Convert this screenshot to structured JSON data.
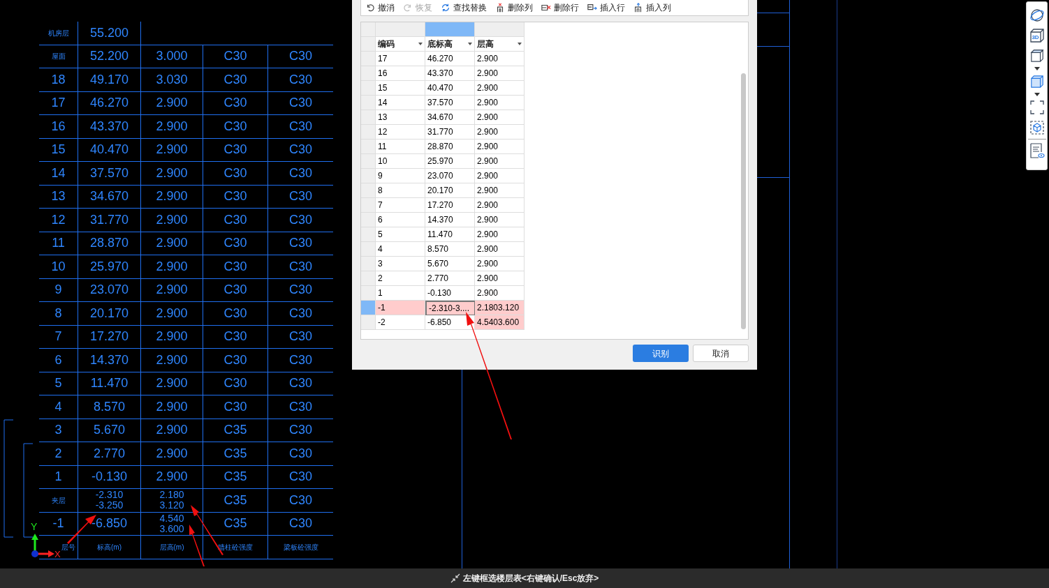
{
  "cad_table": {
    "rows": [
      {
        "cells": [
          "机房层",
          "55.200"
        ]
      },
      {
        "cells": [
          "屋面",
          "52.200",
          "3.000",
          "C30",
          "C30"
        ]
      },
      {
        "cells": [
          "18",
          "49.170",
          "3.030",
          "C30",
          "C30"
        ]
      },
      {
        "cells": [
          "17",
          "46.270",
          "2.900",
          "C30",
          "C30"
        ]
      },
      {
        "cells": [
          "16",
          "43.370",
          "2.900",
          "C30",
          "C30"
        ]
      },
      {
        "cells": [
          "15",
          "40.470",
          "2.900",
          "C30",
          "C30"
        ]
      },
      {
        "cells": [
          "14",
          "37.570",
          "2.900",
          "C30",
          "C30"
        ]
      },
      {
        "cells": [
          "13",
          "34.670",
          "2.900",
          "C30",
          "C30"
        ]
      },
      {
        "cells": [
          "12",
          "31.770",
          "2.900",
          "C30",
          "C30"
        ]
      },
      {
        "cells": [
          "11",
          "28.870",
          "2.900",
          "C30",
          "C30"
        ]
      },
      {
        "cells": [
          "10",
          "25.970",
          "2.900",
          "C30",
          "C30"
        ]
      },
      {
        "cells": [
          "9",
          "23.070",
          "2.900",
          "C30",
          "C30"
        ]
      },
      {
        "cells": [
          "8",
          "20.170",
          "2.900",
          "C30",
          "C30"
        ]
      },
      {
        "cells": [
          "7",
          "17.270",
          "2.900",
          "C30",
          "C30"
        ]
      },
      {
        "cells": [
          "6",
          "14.370",
          "2.900",
          "C30",
          "C30"
        ]
      },
      {
        "cells": [
          "5",
          "11.470",
          "2.900",
          "C30",
          "C30"
        ]
      },
      {
        "cells": [
          "4",
          "8.570",
          "2.900",
          "C30",
          "C30"
        ]
      },
      {
        "cells": [
          "3",
          "5.670",
          "2.900",
          "C35",
          "C30"
        ]
      },
      {
        "cells": [
          "2",
          "2.770",
          "2.900",
          "C35",
          "C30"
        ]
      },
      {
        "cells": [
          "1",
          "-0.130",
          "2.900",
          "C35",
          "C30"
        ]
      },
      {
        "cells": [
          "夹层",
          "-2.310\n-3.250",
          "2.180\n3.120",
          "C35",
          "C30"
        ]
      },
      {
        "cells": [
          "-1",
          "-6.850",
          "4.540\n3.600",
          "C35",
          "C30"
        ]
      },
      {
        "cells": [
          "层号",
          "标高(m)",
          "层高(m)",
          "墙柱砼强度",
          "梁板砼强度"
        ]
      }
    ]
  },
  "axis": {
    "x_label": "X",
    "y_label": "Y"
  },
  "dialog": {
    "toolbar": [
      {
        "kind": "undo",
        "label": "撤消",
        "disabled": false
      },
      {
        "kind": "redo",
        "label": "恢复",
        "disabled": true
      },
      {
        "kind": "replace",
        "label": "查找替换",
        "disabled": false
      },
      {
        "kind": "delete_column",
        "label": "删除列",
        "disabled": false
      },
      {
        "kind": "delete_row",
        "label": "删除行",
        "disabled": false
      },
      {
        "kind": "insert_row",
        "label": "插入行",
        "disabled": false
      },
      {
        "kind": "insert_column",
        "label": "插入列",
        "disabled": false
      }
    ],
    "columns": [
      {
        "label": "编码",
        "selected": false
      },
      {
        "label": "底标高",
        "selected": true
      },
      {
        "label": "层高",
        "selected": false
      }
    ],
    "rows": [
      {
        "selected": false,
        "cells": [
          {
            "text": "17",
            "invalid": false,
            "focused": false
          },
          {
            "text": "46.270",
            "invalid": false,
            "focused": false
          },
          {
            "text": "2.900",
            "invalid": false,
            "focused": false
          }
        ]
      },
      {
        "selected": false,
        "cells": [
          {
            "text": "16",
            "invalid": false,
            "focused": false
          },
          {
            "text": "43.370",
            "invalid": false,
            "focused": false
          },
          {
            "text": "2.900",
            "invalid": false,
            "focused": false
          }
        ]
      },
      {
        "selected": false,
        "cells": [
          {
            "text": "15",
            "invalid": false,
            "focused": false
          },
          {
            "text": "40.470",
            "invalid": false,
            "focused": false
          },
          {
            "text": "2.900",
            "invalid": false,
            "focused": false
          }
        ]
      },
      {
        "selected": false,
        "cells": [
          {
            "text": "14",
            "invalid": false,
            "focused": false
          },
          {
            "text": "37.570",
            "invalid": false,
            "focused": false
          },
          {
            "text": "2.900",
            "invalid": false,
            "focused": false
          }
        ]
      },
      {
        "selected": false,
        "cells": [
          {
            "text": "13",
            "invalid": false,
            "focused": false
          },
          {
            "text": "34.670",
            "invalid": false,
            "focused": false
          },
          {
            "text": "2.900",
            "invalid": false,
            "focused": false
          }
        ]
      },
      {
        "selected": false,
        "cells": [
          {
            "text": "12",
            "invalid": false,
            "focused": false
          },
          {
            "text": "31.770",
            "invalid": false,
            "focused": false
          },
          {
            "text": "2.900",
            "invalid": false,
            "focused": false
          }
        ]
      },
      {
        "selected": false,
        "cells": [
          {
            "text": "11",
            "invalid": false,
            "focused": false
          },
          {
            "text": "28.870",
            "invalid": false,
            "focused": false
          },
          {
            "text": "2.900",
            "invalid": false,
            "focused": false
          }
        ]
      },
      {
        "selected": false,
        "cells": [
          {
            "text": "10",
            "invalid": false,
            "focused": false
          },
          {
            "text": "25.970",
            "invalid": false,
            "focused": false
          },
          {
            "text": "2.900",
            "invalid": false,
            "focused": false
          }
        ]
      },
      {
        "selected": false,
        "cells": [
          {
            "text": "9",
            "invalid": false,
            "focused": false
          },
          {
            "text": "23.070",
            "invalid": false,
            "focused": false
          },
          {
            "text": "2.900",
            "invalid": false,
            "focused": false
          }
        ]
      },
      {
        "selected": false,
        "cells": [
          {
            "text": "8",
            "invalid": false,
            "focused": false
          },
          {
            "text": "20.170",
            "invalid": false,
            "focused": false
          },
          {
            "text": "2.900",
            "invalid": false,
            "focused": false
          }
        ]
      },
      {
        "selected": false,
        "cells": [
          {
            "text": "7",
            "invalid": false,
            "focused": false
          },
          {
            "text": "17.270",
            "invalid": false,
            "focused": false
          },
          {
            "text": "2.900",
            "invalid": false,
            "focused": false
          }
        ]
      },
      {
        "selected": false,
        "cells": [
          {
            "text": "6",
            "invalid": false,
            "focused": false
          },
          {
            "text": "14.370",
            "invalid": false,
            "focused": false
          },
          {
            "text": "2.900",
            "invalid": false,
            "focused": false
          }
        ]
      },
      {
        "selected": false,
        "cells": [
          {
            "text": "5",
            "invalid": false,
            "focused": false
          },
          {
            "text": "11.470",
            "invalid": false,
            "focused": false
          },
          {
            "text": "2.900",
            "invalid": false,
            "focused": false
          }
        ]
      },
      {
        "selected": false,
        "cells": [
          {
            "text": "4",
            "invalid": false,
            "focused": false
          },
          {
            "text": "8.570",
            "invalid": false,
            "focused": false
          },
          {
            "text": "2.900",
            "invalid": false,
            "focused": false
          }
        ]
      },
      {
        "selected": false,
        "cells": [
          {
            "text": "3",
            "invalid": false,
            "focused": false
          },
          {
            "text": "5.670",
            "invalid": false,
            "focused": false
          },
          {
            "text": "2.900",
            "invalid": false,
            "focused": false
          }
        ]
      },
      {
        "selected": false,
        "cells": [
          {
            "text": "2",
            "invalid": false,
            "focused": false
          },
          {
            "text": "2.770",
            "invalid": false,
            "focused": false
          },
          {
            "text": "2.900",
            "invalid": false,
            "focused": false
          }
        ]
      },
      {
        "selected": false,
        "cells": [
          {
            "text": "1",
            "invalid": false,
            "focused": false
          },
          {
            "text": "-0.130",
            "invalid": false,
            "focused": false
          },
          {
            "text": "2.900",
            "invalid": false,
            "focused": false
          }
        ]
      },
      {
        "selected": true,
        "cells": [
          {
            "text": "-1",
            "invalid": true,
            "focused": false
          },
          {
            "text": "-2.310-3....",
            "invalid": true,
            "focused": true
          },
          {
            "text": "2.1803.120",
            "invalid": true,
            "focused": false
          }
        ]
      },
      {
        "selected": false,
        "cells": [
          {
            "text": "-2",
            "invalid": false,
            "focused": false
          },
          {
            "text": "-6.850",
            "invalid": false,
            "focused": false
          },
          {
            "text": "4.5403.600",
            "invalid": true,
            "focused": false
          }
        ]
      }
    ],
    "buttons": [
      {
        "kind": "primary",
        "label": "识别"
      },
      {
        "kind": "secondary",
        "label": "取消"
      }
    ]
  },
  "view_toolbar": [
    {
      "kind": "orbit"
    },
    {
      "kind": "cube_3d",
      "label": "3D"
    },
    {
      "kind": "cube"
    },
    {
      "kind": "caret"
    },
    {
      "kind": "cube_filled"
    },
    {
      "kind": "caret"
    },
    {
      "kind": "frame"
    },
    {
      "kind": "box_select"
    },
    {
      "kind": "divider"
    },
    {
      "kind": "doc_eye"
    }
  ],
  "status_bar": {
    "prompt": "左键框选楼层表<右键确认/Esc放弃>"
  }
}
